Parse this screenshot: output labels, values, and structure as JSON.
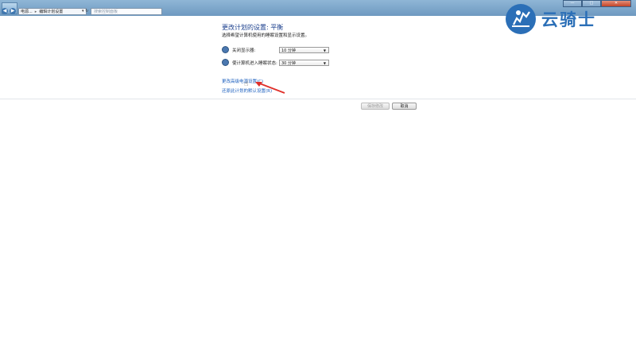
{
  "window": {
    "nav_back": "◀",
    "nav_forward": "▶",
    "breadcrumb": [
      "电源...",
      "编辑计划设置"
    ],
    "breadcrumb_separator": "▸",
    "refresh_icon": "▾ ↻",
    "search_placeholder": "搜索控制面板",
    "controls": {
      "minimize": "—",
      "maximize": "□",
      "close": "✕"
    }
  },
  "watermark": {
    "text": "云骑士",
    "color": "#2b6fb7"
  },
  "page": {
    "title": "更改计划的设置: 平衡",
    "description": "选择希望计算机使用的睡眠设置和显示设置。",
    "settings": [
      {
        "label": "关闭显示器:",
        "value": "10 分钟",
        "icon": "monitor-icon"
      },
      {
        "label": "使计算机进入睡眠状态:",
        "value": "30 分钟",
        "icon": "moon-icon"
      }
    ],
    "links": {
      "advanced": "更改高级电源设置(C)",
      "restore": "还原此计划的默认设置(R)"
    },
    "buttons": {
      "save": "保存修改",
      "cancel": "取消"
    }
  },
  "colors": {
    "title_blue": "#1a3e8c",
    "link_blue": "#1b5fbf",
    "annotation_red": "#e0302a"
  }
}
